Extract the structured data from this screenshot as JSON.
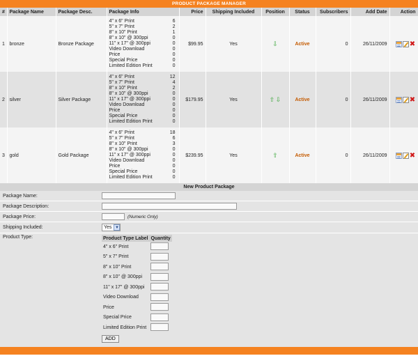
{
  "title": "PRODUCT PACKAGE MANAGER",
  "columns": {
    "num": "#",
    "name": "Package Name",
    "desc": "Package Desc.",
    "info": "Package Info",
    "price": "Price",
    "shipping": "Shipping Included",
    "position": "Position",
    "status": "Status",
    "subscribers": "Subscribers",
    "add_date": "Add Date",
    "action": "Action"
  },
  "packages": [
    {
      "num": "1",
      "name": "bronze",
      "desc": "Bronze Package",
      "info": [
        {
          "label": "4\" x 6\" Print",
          "qty": "6"
        },
        {
          "label": "5\" x 7\" Print",
          "qty": "2"
        },
        {
          "label": "8\" x 10\" Print",
          "qty": "1"
        },
        {
          "label": "8\" x 10\" @ 300ppi",
          "qty": "0"
        },
        {
          "label": "11\" x 17\" @ 300ppi",
          "qty": "0"
        },
        {
          "label": "Video Download",
          "qty": "0"
        },
        {
          "label": "Price",
          "qty": "0"
        },
        {
          "label": "Special Price",
          "qty": "0"
        },
        {
          "label": "Limited Edition Print",
          "qty": "0"
        }
      ],
      "price": "$99.95",
      "shipping": "Yes",
      "position_up": false,
      "position_down": true,
      "status": "Active",
      "subscribers": "0",
      "add_date": "26/11/2009"
    },
    {
      "num": "2",
      "name": "silver",
      "desc": "Silver Package",
      "info": [
        {
          "label": "4\" x 6\" Print",
          "qty": "12"
        },
        {
          "label": "5\" x 7\" Print",
          "qty": "4"
        },
        {
          "label": "8\" x 10\" Print",
          "qty": "2"
        },
        {
          "label": "8\" x 10\" @ 300ppi",
          "qty": "0"
        },
        {
          "label": "11\" x 17\" @ 300ppi",
          "qty": "0"
        },
        {
          "label": "Video Download",
          "qty": "0"
        },
        {
          "label": "Price",
          "qty": "0"
        },
        {
          "label": "Special Price",
          "qty": "0"
        },
        {
          "label": "Limited Edition Print",
          "qty": "0"
        }
      ],
      "price": "$179.95",
      "shipping": "Yes",
      "position_up": true,
      "position_down": true,
      "status": "Active",
      "subscribers": "0",
      "add_date": "26/11/2009"
    },
    {
      "num": "3",
      "name": "gold",
      "desc": "Gold Package",
      "info": [
        {
          "label": "4\" x 6\" Print",
          "qty": "18"
        },
        {
          "label": "5\" x 7\" Print",
          "qty": "6"
        },
        {
          "label": "8\" x 10\" Print",
          "qty": "3"
        },
        {
          "label": "8\" x 10\" @ 300ppi",
          "qty": "0"
        },
        {
          "label": "11\" x 17\" @ 300ppi",
          "qty": "0"
        },
        {
          "label": "Video Download",
          "qty": "0"
        },
        {
          "label": "Price",
          "qty": "0"
        },
        {
          "label": "Special Price",
          "qty": "0"
        },
        {
          "label": "Limited Edition Print",
          "qty": "0"
        }
      ],
      "price": "$239.95",
      "shipping": "Yes",
      "position_up": true,
      "position_down": false,
      "status": "Active",
      "subscribers": "0",
      "add_date": "26/11/2009"
    }
  ],
  "icons": {
    "up": "arrow-up-icon",
    "down": "arrow-down-icon",
    "schedule": "calendar-icon",
    "edit": "edit-icon",
    "delete": "delete-icon"
  },
  "colors": {
    "accent": "#f58220",
    "status_active": "#c45a00",
    "position_arrow": "#3aa53a",
    "delete": "#d01818"
  },
  "new_package": {
    "heading": "New Product Package",
    "name_label": "Package Name:",
    "name_value": "",
    "desc_label": "Package Description:",
    "desc_value": "",
    "price_label": "Package Price:",
    "price_value": "",
    "price_hint": "(Numeric Only)",
    "shipping_label": "Shipping Included:",
    "shipping_value": "Yes",
    "type_label": "Product Type:",
    "type_header_label": "Product Type Label",
    "type_header_qty": "Quantity",
    "types": [
      "4\" x 6\" Print",
      "5\" x 7\" Print",
      "8\" x 10\" Print",
      "8\" x 10\" @ 300ppi",
      "11\" x 17\" @ 300ppi",
      "Video Download",
      "Price",
      "Special Price",
      "Limited Edition Print"
    ],
    "add_button": "ADD"
  }
}
